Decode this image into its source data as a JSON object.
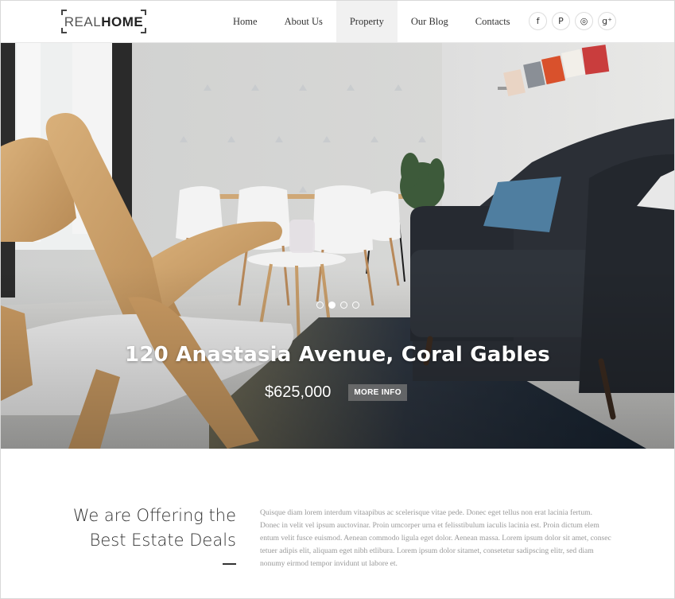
{
  "brand": {
    "logo_light": "REAL",
    "logo_bold": "HOME"
  },
  "nav": [
    {
      "label": "Home"
    },
    {
      "label": "About Us"
    },
    {
      "label": "Property",
      "active": true
    },
    {
      "label": "Our Blog"
    },
    {
      "label": "Contacts"
    }
  ],
  "social": [
    {
      "icon": "facebook-icon",
      "glyph": "f"
    },
    {
      "icon": "pinterest-icon",
      "glyph": "P"
    },
    {
      "icon": "instagram-icon",
      "glyph": "◎"
    },
    {
      "icon": "googleplus-icon",
      "glyph": "g⁺"
    }
  ],
  "hero": {
    "title": "120 Anastasia Avenue, Coral Gables",
    "price": "$625,000",
    "more_label": "MORE INFO",
    "slides": 4,
    "active_slide": 2
  },
  "offer": {
    "title_line1": "We are Offering the",
    "title_line2": "Best Estate Deals",
    "body": "Quisque diam lorem interdum vitaapibus ac scelerisque vitae pede. Donec eget tellus non erat lacinia fertum. Donec in velit vel ipsum auctovinar. Proin umcorper urna et felisstibulum iaculis lacinia est. Proin dictum elem entum velit fusce euismod. Aenean commodo ligula eget dolor. Aenean massa. Lorem ipsum dolor sit amet, consec tetuer adipis elit, aliquam eget nibh etlibura. Lorem ipsum dolor sitamet, consetetur sadipscing elitr, sed diam nonumy eirmod tempor invidunt ut labore et."
  },
  "colors": {
    "nav_active_bg": "#f1f1f1",
    "sofa": "#2b2f36",
    "rug": "#1e2a38"
  }
}
